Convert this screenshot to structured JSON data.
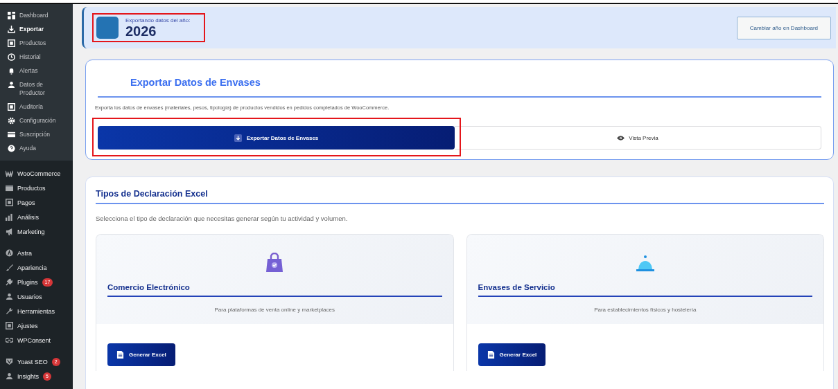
{
  "sidebar": {
    "submenu": [
      {
        "label": "Dashboard",
        "selected": false
      },
      {
        "label": "Exportar",
        "selected": true
      },
      {
        "label": "Productos",
        "selected": false
      },
      {
        "label": "Historial",
        "selected": false
      },
      {
        "label": "Alertas",
        "selected": false
      },
      {
        "label": "Datos de Productor",
        "selected": false
      },
      {
        "label": "Auditoría",
        "selected": false
      },
      {
        "label": "Configuración",
        "selected": false
      },
      {
        "label": "Suscripción",
        "selected": false
      },
      {
        "label": "Ayuda",
        "selected": false
      }
    ],
    "groups": [
      [
        {
          "label": "WooCommerce"
        },
        {
          "label": "Productos"
        },
        {
          "label": "Pagos"
        },
        {
          "label": "Análisis"
        },
        {
          "label": "Marketing"
        }
      ],
      [
        {
          "label": "Astra"
        },
        {
          "label": "Apariencia"
        },
        {
          "label": "Plugins",
          "badge": "17"
        },
        {
          "label": "Usuarios"
        },
        {
          "label": "Herramientas"
        },
        {
          "label": "Ajustes"
        },
        {
          "label": "WPConsent"
        }
      ],
      [
        {
          "label": "Yoast SEO",
          "badge": "2"
        },
        {
          "label": "Insights",
          "badge": "5"
        }
      ]
    ]
  },
  "year_banner": {
    "caption": "Exportando datos del año:",
    "year": "2026",
    "button": "Cambiar año en Dashboard"
  },
  "export_card": {
    "title": "Exportar Datos de Envases",
    "description": "Exporta los datos de envases (materiales, pesos, tipología) de productos vendidos en pedidos completados de WooCommerce.",
    "export_button": "Exportar Datos de Envases",
    "preview_button": "Vista Previa"
  },
  "declaration_card": {
    "title": "Tipos de Declaración Excel",
    "description": "Selecciona el tipo de declaración que necesitas generar según tu actividad y volumen.",
    "types": [
      {
        "kind": "bag",
        "title": "Comercio Electrónico",
        "subtitle": "Para plataformas de venta online y marketplaces",
        "button": "Generar Excel"
      },
      {
        "kind": "bell",
        "title": "Envases de Servicio",
        "subtitle": "Para establecimientos físicos y hostelería",
        "button": "Generar Excel"
      }
    ]
  }
}
